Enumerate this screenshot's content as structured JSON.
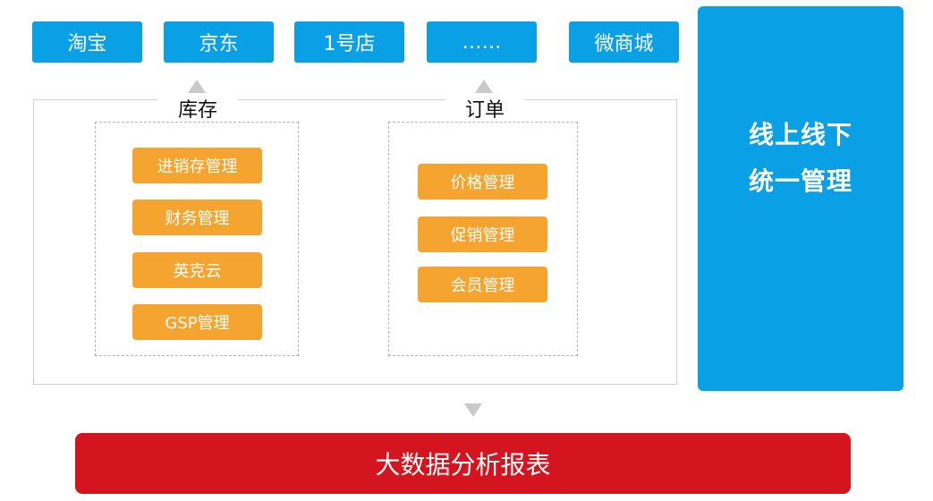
{
  "platforms": [
    "淘宝",
    "京东",
    "1号店",
    "……",
    "微商城"
  ],
  "inventory": {
    "title": "库存",
    "modules": [
      "进销存管理",
      "财务管理",
      "英克云",
      "GSP管理"
    ]
  },
  "orders": {
    "title": "订单",
    "modules": [
      "价格管理",
      "促销管理",
      "会员管理"
    ]
  },
  "side_panel": {
    "line1": "线上线下",
    "line2": "统一管理"
  },
  "bottom_bar": {
    "label": "大数据分析报表"
  },
  "colors": {
    "platform_blue": "#0aa0e6",
    "module_orange": "#f5a52f",
    "bottom_red": "#d4141e",
    "arrow_gray": "#c9c9c9"
  }
}
